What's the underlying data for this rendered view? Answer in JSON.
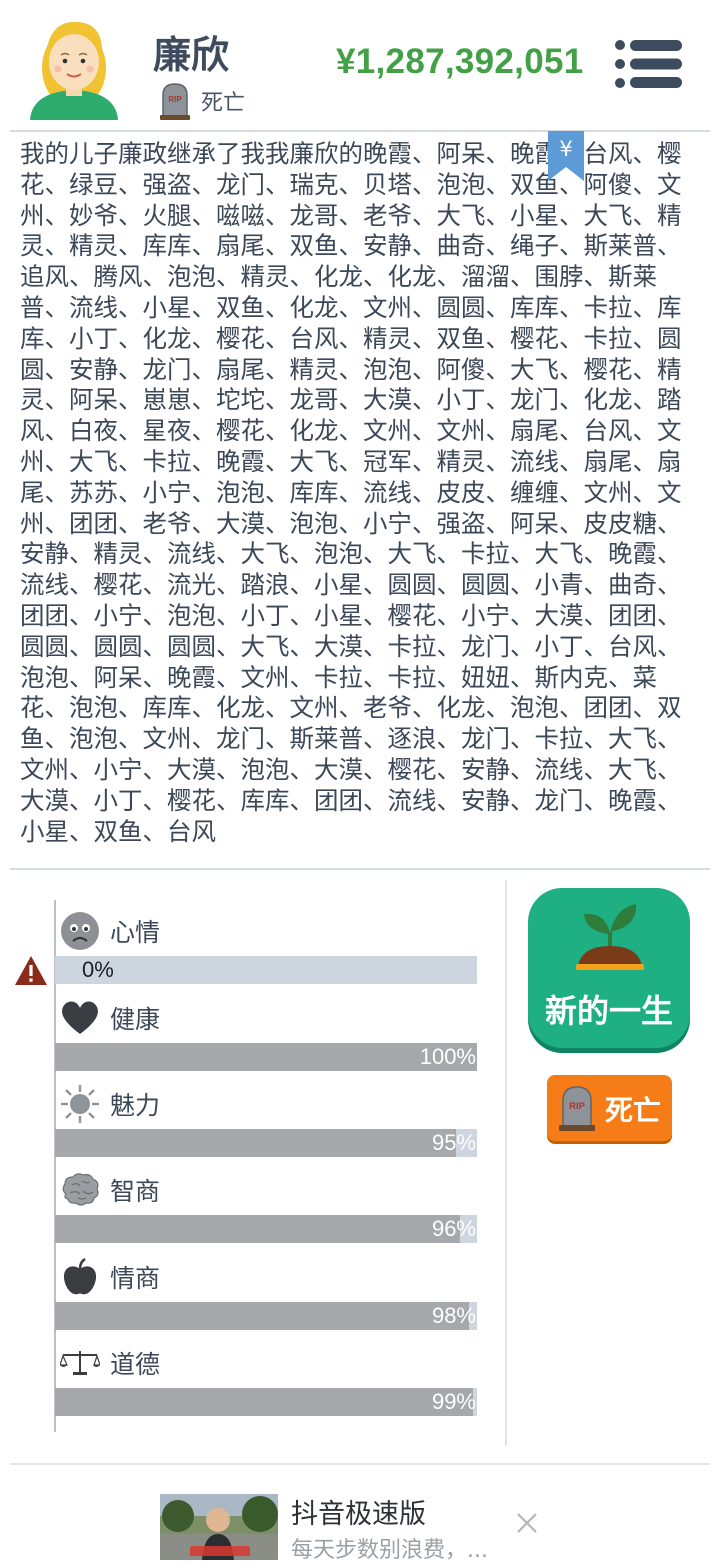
{
  "header": {
    "name": "廉欣",
    "status_label": "死亡",
    "money": "¥1,287,392,051"
  },
  "story": {
    "bookmark_symbol": "¥",
    "text": "我的儿子廉政继承了我我廉欣的晚霞、阿呆、晚霞、台风、樱花、绿豆、强盗、龙门、瑞克、贝塔、泡泡、双鱼、阿傻、文州、妙爷、火腿、嗞嗞、龙哥、老爷、大飞、小星、大飞、精灵、精灵、库库、扇尾、双鱼、安静、曲奇、绳子、斯莱普、追风、腾风、泡泡、精灵、化龙、化龙、溜溜、围脖、斯莱普、流线、小星、双鱼、化龙、文州、圆圆、库库、卡拉、库库、小丁、化龙、樱花、台风、精灵、双鱼、樱花、卡拉、圆圆、安静、龙门、扇尾、精灵、泡泡、阿傻、大飞、樱花、精灵、阿呆、崽崽、坨坨、龙哥、大漠、小丁、龙门、化龙、踏风、白夜、星夜、樱花、化龙、文州、文州、扇尾、台风、文州、大飞、卡拉、晚霞、大飞、冠军、精灵、流线、扇尾、扇尾、苏苏、小宁、泡泡、库库、流线、皮皮、缠缠、文州、文州、团团、老爷、大漠、泡泡、小宁、强盗、阿呆、皮皮糖、安静、精灵、流线、大飞、泡泡、大飞、卡拉、大飞、晚霞、流线、樱花、流光、踏浪、小星、圆圆、圆圆、小青、曲奇、团团、小宁、泡泡、小丁、小星、樱花、小宁、大漠、团团、圆圆、圆圆、圆圆、大飞、大漠、卡拉、龙门、小丁、台风、泡泡、阿呆、晚霞、文州、卡拉、卡拉、妞妞、斯内克、菜花、泡泡、库库、化龙、文州、老爷、化龙、泡泡、团团、双鱼、泡泡、文州、龙门、斯莱普、逐浪、龙门、卡拉、大飞、文州、小宁、大漠、泡泡、大漠、樱花、安静、流线、大飞、大漠、小丁、樱花、库库、团团、流线、安静、龙门、晚霞、小星、双鱼、台风"
  },
  "stats": [
    {
      "key": "mood",
      "label": "心情",
      "icon": "sad-face-icon",
      "value": 0,
      "display": "0%"
    },
    {
      "key": "health",
      "label": "健康",
      "icon": "heart-icon",
      "value": 100,
      "display": "100%"
    },
    {
      "key": "charm",
      "label": "魅力",
      "icon": "sun-icon",
      "value": 95,
      "display": "95%"
    },
    {
      "key": "iq",
      "label": "智商",
      "icon": "brain-icon",
      "value": 96,
      "display": "96%"
    },
    {
      "key": "eq",
      "label": "情商",
      "icon": "apple-icon",
      "value": 98,
      "display": "98%"
    },
    {
      "key": "morality",
      "label": "道德",
      "icon": "scales-icon",
      "value": 99,
      "display": "99%"
    }
  ],
  "actions": {
    "new_life_label": "新的一生",
    "die_label": "死亡"
  },
  "ad": {
    "title": "抖音极速版",
    "description": "每天步数别浪费，..."
  },
  "colors": {
    "money": "#43a047",
    "new_life_button": "#1eaf82",
    "die_button": "#f57c17",
    "bar_track": "#cdd5de",
    "bar_fill": "#a6a8ab"
  }
}
